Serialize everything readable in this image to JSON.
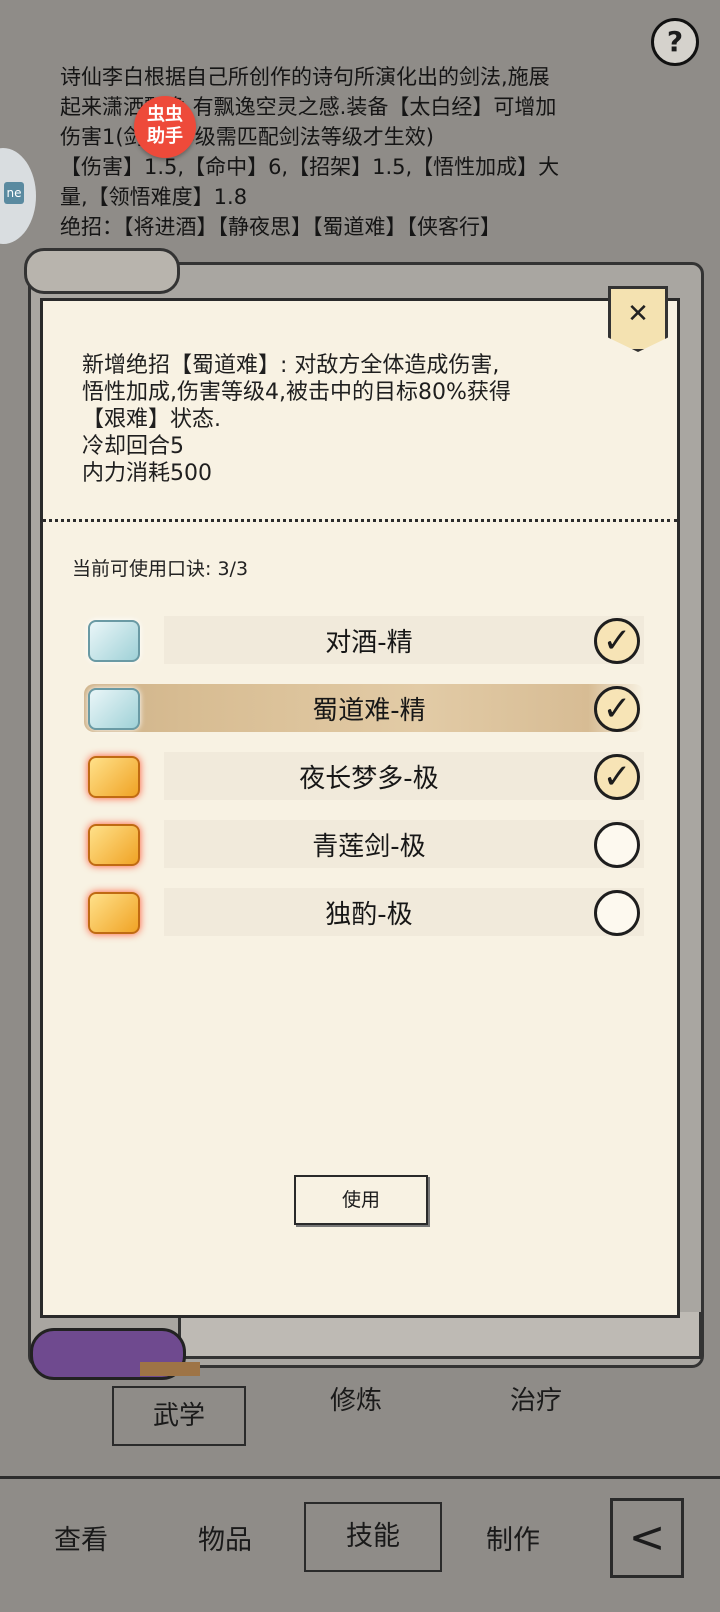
{
  "background": {
    "description_lines": [
      "诗仙李白根据自己所创作的诗句所演化出的剑法,施展",
      "起来潇洒飘逸,有飘逸空灵之感.装备【太白经】可增加",
      "伤害1(剑法)等级需匹配剑法等级才生效)",
      "【伤害】1.5,【命中】6,【招架】1.5,【悟性加成】大",
      "量,【领悟难度】1.8",
      "绝招：【将进酒】【静夜思】【蜀道难】【侠客行】"
    ],
    "help_label": "?",
    "badge_line1": "虫虫",
    "badge_line2": "助手",
    "side_badge_label": "ne"
  },
  "modal": {
    "close_label": "✕",
    "desc_lines": [
      "新增绝招【蜀道难】: 对敌方全体造成伤害,",
      "悟性加成,伤害等级4,被击中的目标80%获得",
      "【艰难】状态.",
      "冷却回合5",
      "内力消耗500"
    ],
    "available_label": "当前可使用口诀:",
    "available_value": "3/3",
    "items": [
      {
        "name": "对酒-精",
        "icon": "silver-scroll-icon",
        "checked": true,
        "check_label": "✓"
      },
      {
        "name": "蜀道难-精",
        "icon": "silver-scroll-icon",
        "checked": true,
        "check_label": "✓"
      },
      {
        "name": "夜长梦多-极",
        "icon": "gold-scroll-icon",
        "checked": true,
        "check_label": "✓"
      },
      {
        "name": "青莲剑-极",
        "icon": "gold-scroll-icon",
        "checked": false,
        "check_label": ""
      },
      {
        "name": "独酌-极",
        "icon": "gold-scroll-icon",
        "checked": false,
        "check_label": ""
      }
    ],
    "use_button": "使用"
  },
  "sub_tabs": [
    "武学",
    "修炼",
    "治疗"
  ],
  "nav": [
    "查看",
    "物品",
    "技能",
    "制作"
  ],
  "back_label": "<"
}
